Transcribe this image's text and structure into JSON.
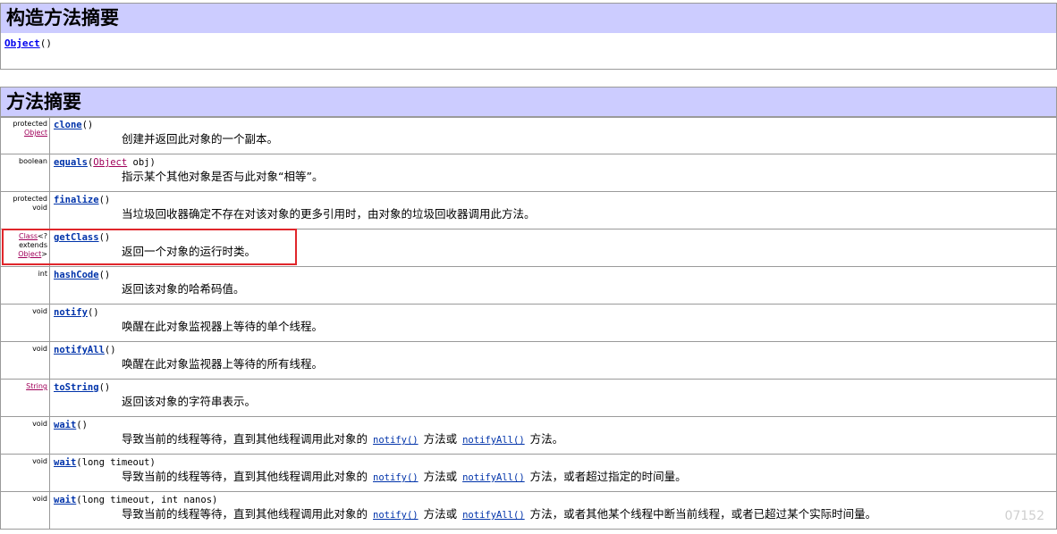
{
  "constructor_summary": {
    "heading": "构造方法摘要",
    "constructor_name": "Object",
    "constructor_parens": "()"
  },
  "method_summary": {
    "heading": "方法摘要",
    "rows": [
      {
        "mod1": "protected",
        "mod_type": "Object",
        "mod2": "",
        "mod3": "",
        "name": "clone",
        "args_pre": "()",
        "arg_type": "",
        "args_post": "",
        "desc1": "创建并返回此对象的一个副本。",
        "link1": "",
        "desc2": "",
        "link2": "",
        "desc3": ""
      },
      {
        "mod1": "boolean",
        "mod_type": "",
        "mod2": "",
        "mod3": "",
        "name": "equals",
        "args_pre": "(",
        "arg_type": "Object",
        "args_post": " obj)",
        "desc1": "指示某个其他对象是否与此对象“相等”。",
        "link1": "",
        "desc2": "",
        "link2": "",
        "desc3": ""
      },
      {
        "mod1": "protected",
        "mod_type": "",
        "mod2": "void",
        "mod3": "",
        "name": "finalize",
        "args_pre": "()",
        "arg_type": "",
        "args_post": "",
        "desc1": "当垃圾回收器确定不存在对该对象的更多引用时，由对象的垃圾回收器调用此方法。",
        "link1": "",
        "desc2": "",
        "link2": "",
        "desc3": ""
      },
      {
        "mod1": "",
        "mod_type": "Class",
        "mod2": "<?",
        "mod3": "extends",
        "mod_type2": "Object",
        "mod4": ">",
        "name": "getClass",
        "args_pre": "()",
        "arg_type": "",
        "args_post": "",
        "desc1": "返回一个对象的运行时类。",
        "link1": "",
        "desc2": "",
        "link2": "",
        "desc3": ""
      },
      {
        "mod1": "int",
        "mod_type": "",
        "mod2": "",
        "mod3": "",
        "name": "hashCode",
        "args_pre": "()",
        "arg_type": "",
        "args_post": "",
        "desc1": "返回该对象的哈希码值。",
        "link1": "",
        "desc2": "",
        "link2": "",
        "desc3": ""
      },
      {
        "mod1": "void",
        "mod_type": "",
        "mod2": "",
        "mod3": "",
        "name": "notify",
        "args_pre": "()",
        "arg_type": "",
        "args_post": "",
        "desc1": "唤醒在此对象监视器上等待的单个线程。",
        "link1": "",
        "desc2": "",
        "link2": "",
        "desc3": ""
      },
      {
        "mod1": "void",
        "mod_type": "",
        "mod2": "",
        "mod3": "",
        "name": "notifyAll",
        "args_pre": "()",
        "arg_type": "",
        "args_post": "",
        "desc1": "唤醒在此对象监视器上等待的所有线程。",
        "link1": "",
        "desc2": "",
        "link2": "",
        "desc3": ""
      },
      {
        "mod1": "",
        "mod_type": "String",
        "mod2": "",
        "mod3": "",
        "name": "toString",
        "args_pre": "()",
        "arg_type": "",
        "args_post": "",
        "desc1": "返回该对象的字符串表示。",
        "link1": "",
        "desc2": "",
        "link2": "",
        "desc3": ""
      },
      {
        "mod1": "void",
        "mod_type": "",
        "mod2": "",
        "mod3": "",
        "name": "wait",
        "args_pre": "()",
        "arg_type": "",
        "args_post": "",
        "desc1": "导致当前的线程等待，直到其他线程调用此对象的",
        "link1": "notify()",
        "desc2": "方法或",
        "link2": "notifyAll()",
        "desc3": "方法。"
      },
      {
        "mod1": "void",
        "mod_type": "",
        "mod2": "",
        "mod3": "",
        "name": "wait",
        "args_pre": "(long timeout)",
        "arg_type": "",
        "args_post": "",
        "desc1": "导致当前的线程等待，直到其他线程调用此对象的",
        "link1": "notify()",
        "desc2": "方法或",
        "link2": "notifyAll()",
        "desc3": "方法，或者超过指定的时间量。"
      },
      {
        "mod1": "void",
        "mod_type": "",
        "mod2": "",
        "mod3": "",
        "name": "wait",
        "args_pre": "(long timeout, int nanos)",
        "arg_type": "",
        "args_post": "",
        "desc1": "导致当前的线程等待，直到其他线程调用此对象的",
        "link1": "notify()",
        "desc2": "方法或",
        "link2": "notifyAll()",
        "desc3": "方法，或者其他某个线程中断当前线程，或者已超过某个实际时间量。"
      }
    ]
  },
  "watermark": "07152",
  "colors": {
    "header_bg": "#ccccff",
    "highlight": "#e0262b",
    "link": "#0033aa",
    "type_link": "#a0005a"
  }
}
